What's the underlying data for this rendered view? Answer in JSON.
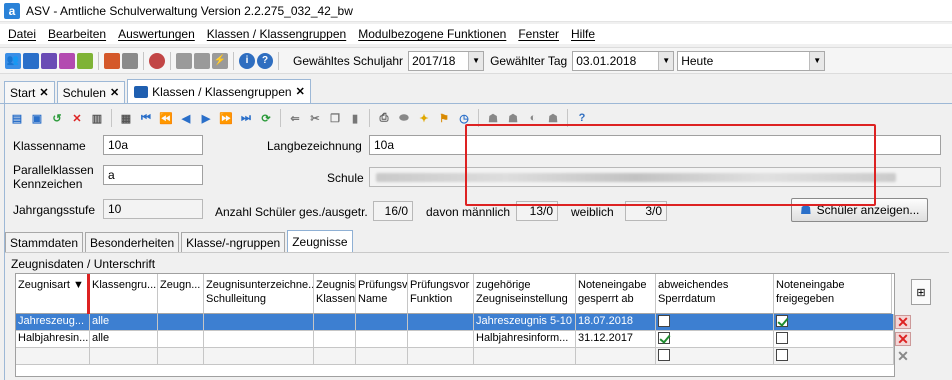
{
  "window": {
    "title": "ASV - Amtliche Schulverwaltung Version 2.2.275_032_42_bw"
  },
  "menu": [
    "Datei",
    "Bearbeiten",
    "Auswertungen",
    "Klassen / Klassengruppen",
    "Modulbezogene Funktionen",
    "Fenster",
    "Hilfe"
  ],
  "toolbar": {
    "schuljahr_label": "Gewähltes Schuljahr",
    "schuljahr_value": "2017/18",
    "tag_label": "Gewählter Tag",
    "tag_value": "03.01.2018",
    "heute_value": "Heute"
  },
  "tabs": [
    {
      "label": "Start"
    },
    {
      "label": "Schulen"
    },
    {
      "label": "Klassen / Klassengruppen"
    }
  ],
  "form": {
    "klassenname_label": "Klassenname",
    "klassenname_value": "10a",
    "parallel_label_1": "Parallelklassen",
    "parallel_label_2": "Kennzeichen",
    "parallel_value": "a",
    "jahrgang_label": "Jahrgangsstufe",
    "jahrgang_value": "10",
    "langbez_label": "Langbezeichnung",
    "langbez_value": "10a",
    "schule_label": "Schule",
    "anzahl_label": "Anzahl Schüler ges./ausgetr.",
    "anzahl_value": "16/0",
    "maennlich_label": "davon männlich",
    "maennlich_value": "13/0",
    "weiblich_label": "weiblich",
    "weiblich_value": "3/0",
    "schueler_button": "Schüler anzeigen..."
  },
  "subtabs": [
    "Stammdaten",
    "Besonderheiten",
    "Klasse/-ngruppen",
    "Zeugnisse"
  ],
  "group_title": "Zeugnisdaten / Unterschrift",
  "grid": {
    "headers": [
      [
        "Zeugnisart",
        ""
      ],
      [
        "Klassengru...",
        ""
      ],
      [
        "Zeugn...",
        ""
      ],
      [
        "Zeugnisunterzeichne...",
        "Schulleitung"
      ],
      [
        "Zeugnis",
        "Klassenl"
      ],
      [
        "Prüfungsv",
        "Name"
      ],
      [
        "Prüfungsvor",
        "Funktion"
      ],
      [
        "zugehörige",
        "Zeugniseinstellung"
      ],
      [
        "Noteneingabe",
        "gesperrt ab"
      ],
      [
        "abweichendes",
        "Sperrdatum"
      ],
      [
        "Noteneingabe",
        "freigegeben"
      ]
    ],
    "rows": [
      {
        "zeugnisart": "Jahreszeug...",
        "klassengruppe": "alle",
        "einstellung": "Jahreszeugnis 5-10",
        "gesperrt": "18.07.2018",
        "abweichend": false,
        "freigegeben": true
      },
      {
        "zeugnisart": "Halbjahresin...",
        "klassengruppe": "alle",
        "einstellung": "Halbjahresinform...",
        "gesperrt": "31.12.2017",
        "abweichend": true,
        "freigegeben": false
      },
      {
        "zeugnisart": "",
        "klassengruppe": "",
        "einstellung": "",
        "gesperrt": "",
        "abweichend": false,
        "freigegeben": false
      }
    ]
  },
  "colors": {
    "accent": "#3d7fd1",
    "highlight": "#d22222",
    "tab_border": "#9db8d6"
  }
}
